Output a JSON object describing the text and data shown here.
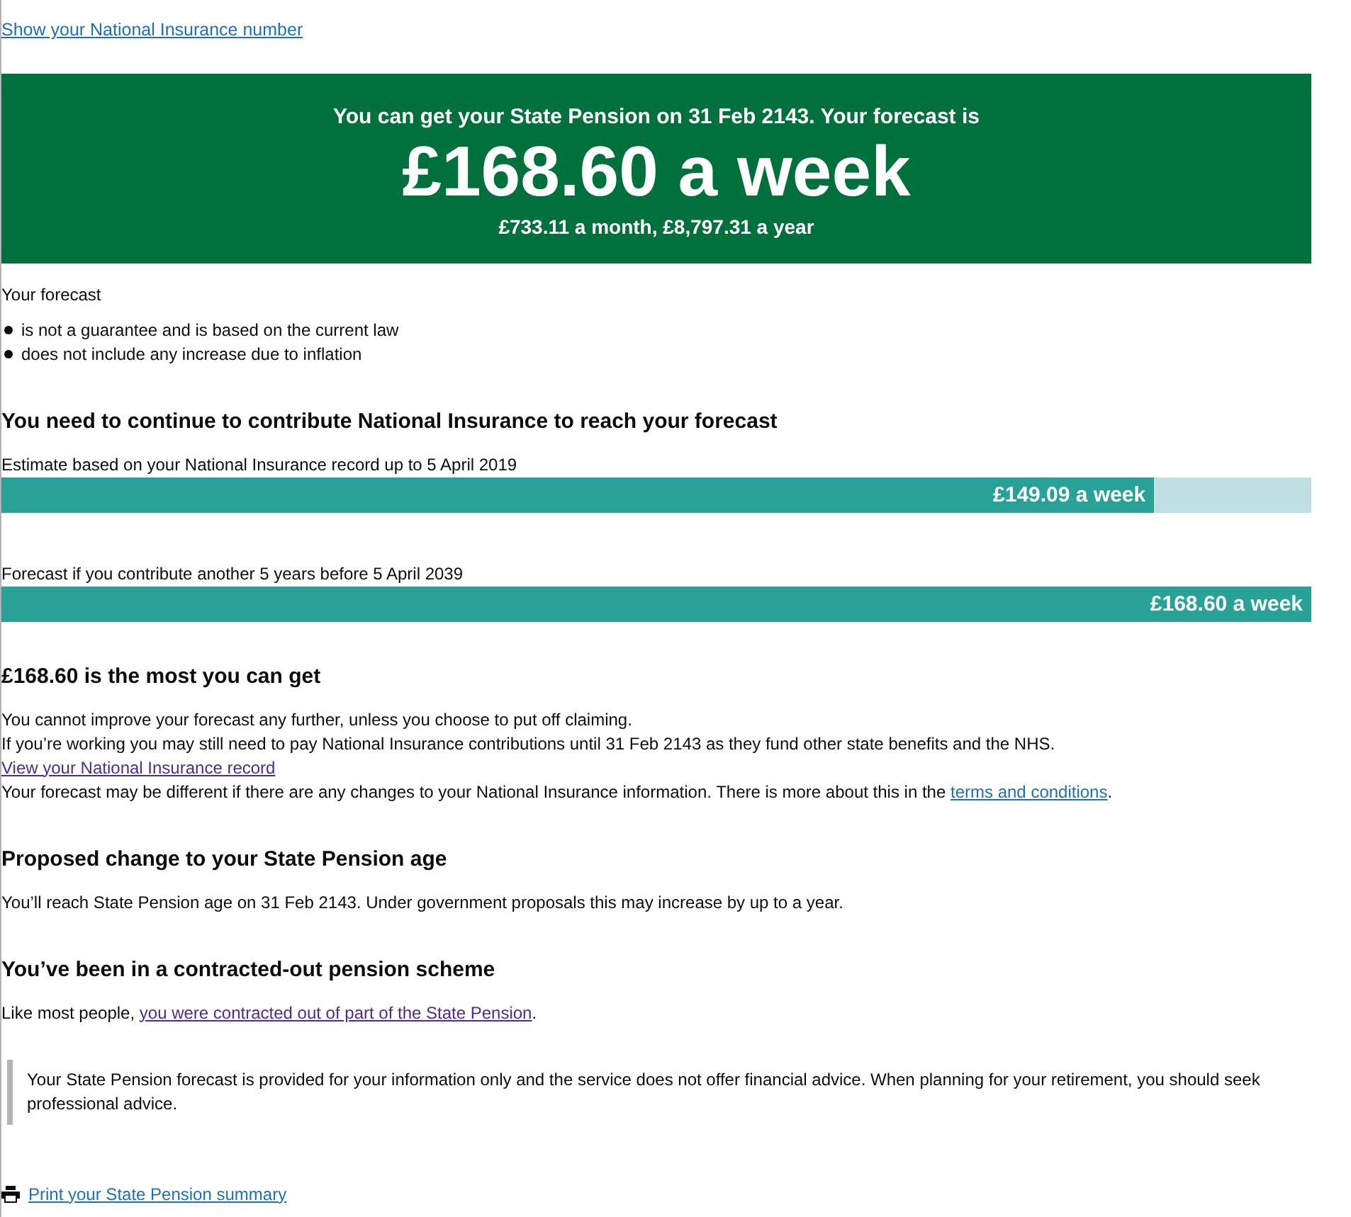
{
  "top_link": {
    "text": "Show your National Insurance number",
    "visited": false
  },
  "banner": {
    "intro": "You can get your State Pension on 31 Feb 2143. Your forecast is",
    "amount": "£168.60 a week",
    "breakdown": "£733.11 a month, £8,797.31 a year"
  },
  "forecast_notes": {
    "intro": "Your forecast",
    "items": [
      "is not a guarantee and is based on the current law",
      "does not include any increase due to inflation"
    ]
  },
  "contribute_section": {
    "heading": "You need to continue to contribute National Insurance to reach your forecast",
    "bars": [
      {
        "label": "Estimate based on your National Insurance record up to 5 April 2019",
        "value": "£149.09 a week",
        "level": 0.88
      },
      {
        "label": "Forecast if you contribute another 5 years before 5 April 2039",
        "value": "£168.60 a week",
        "level": 1
      }
    ]
  },
  "max_section": {
    "heading": "£168.60 is the most you can get",
    "lines": [
      [
        {
          "text": "You cannot improve your forecast any further, unless you choose to put off claiming."
        }
      ],
      [
        {
          "text": "If you’re working you may still need to pay National Insurance contributions until 31 Feb 2143 as they fund other state benefits and the NHS."
        }
      ],
      [
        {
          "text": "View your National Insurance record",
          "link": true,
          "visited": true
        }
      ],
      [
        {
          "text": "Your forecast may be different if there are any changes to your National Insurance information. There is more about this in the "
        },
        {
          "text": "terms and conditions",
          "link": true,
          "visited": false
        },
        {
          "text": "."
        }
      ]
    ]
  },
  "age_section": {
    "heading": "Proposed change to your State Pension age",
    "lines": [
      [
        {
          "text": "You’ll reach State Pension age on 31 Feb 2143. Under government proposals this may increase by up to a year."
        }
      ]
    ]
  },
  "contracted_section": {
    "heading": "You’ve been in a contracted-out pension scheme",
    "lines": [
      [
        {
          "text": "Like most people, "
        },
        {
          "text": "you were contracted out of part of the State Pension",
          "link": true,
          "visited": true
        },
        {
          "text": "."
        }
      ]
    ]
  },
  "inset": "Your State Pension forecast is provided for your information only and the service does not offer financial advice. When planning for your retirement, you should seek professional advice.",
  "print_link": {
    "text": "Print your State Pension summary",
    "visited": false
  }
}
